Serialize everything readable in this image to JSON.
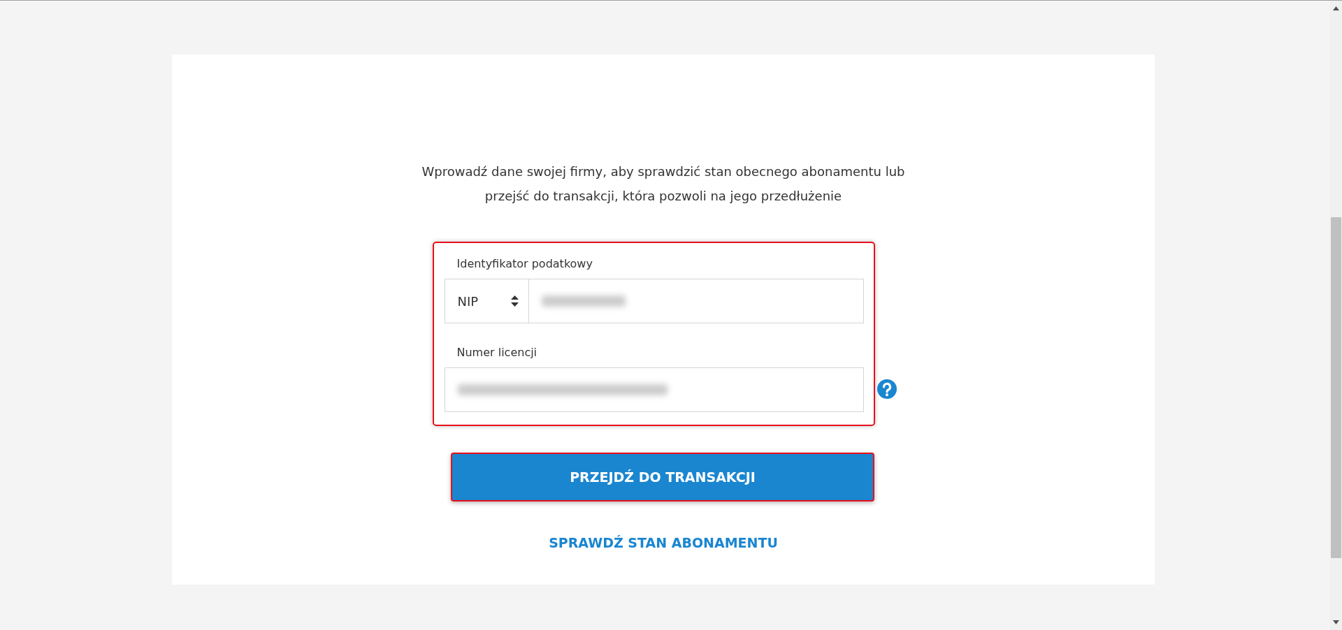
{
  "intro": "Wprowadź dane swojej firmy, aby sprawdzić stan obecnego abonamentu lub przejść do transakcji, która pozwoli na jego przedłużenie",
  "form": {
    "highlighted": true,
    "fields": [
      {
        "kind": "select-input",
        "label": "Identyfikator podatkowy",
        "select": "NIP",
        "value_blurred": true
      },
      {
        "kind": "input",
        "label": "Numer licencji",
        "value_blurred": true,
        "help": true
      }
    ]
  },
  "primary_button": {
    "label": "PRZEJDŹ DO TRANSAKCJI",
    "highlighted": true
  },
  "link": "SPRAWDŹ STAN ABONAMENTU"
}
